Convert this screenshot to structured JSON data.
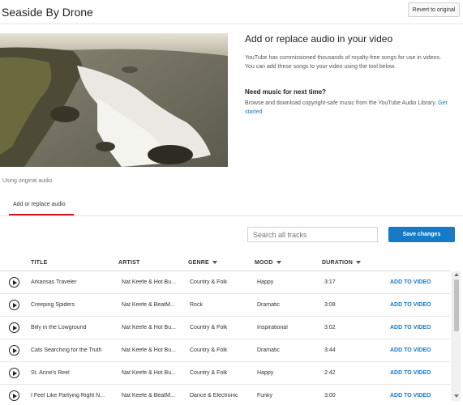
{
  "header": {
    "title": "Seaside By Drone",
    "revert_label": "Revert to original"
  },
  "info": {
    "heading": "Add or replace audio in your video",
    "description": "YouTube has commissioned thousands of royalty-free songs for use in videos. You can add these songs to your video using the tool below.",
    "subheading": "Need music for next time?",
    "description2": "Browse and download copyright-safe music from the YouTube Audio Library.",
    "link": "Get started"
  },
  "audio_status": "Using original audio",
  "tabs": [
    {
      "label": "Add or replace audio"
    }
  ],
  "search": {
    "placeholder": "Search all tracks"
  },
  "save_label": "Save changes",
  "columns": {
    "title": "TITLE",
    "artist": "ARTIST",
    "genre": "GENRE",
    "mood": "MOOD",
    "duration": "DURATION"
  },
  "tracks": [
    {
      "title": "Arkansas Traveler",
      "artist": "Nat Keefe & Hot Bu...",
      "genre": "Country & Folk",
      "mood": "Happy",
      "duration": "3:17",
      "action": "ADD TO VIDEO"
    },
    {
      "title": "Creeping Spiders",
      "artist": "Nat Keefe & BeatM...",
      "genre": "Rock",
      "mood": "Dramatic",
      "duration": "3:08",
      "action": "ADD TO VIDEO"
    },
    {
      "title": "Billy in the Lowground",
      "artist": "Nat Keefe & Hot Bu...",
      "genre": "Country & Folk",
      "mood": "Inspirational",
      "duration": "3:02",
      "action": "ADD TO VIDEO"
    },
    {
      "title": "Cats Searching for the Truth",
      "artist": "Nat Keefe & Hot Bu...",
      "genre": "Country & Folk",
      "mood": "Dramatic",
      "duration": "3:44",
      "action": "ADD TO VIDEO"
    },
    {
      "title": "St. Anne's Reel",
      "artist": "Nat Keefe & Hot Bu...",
      "genre": "Country & Folk",
      "mood": "Happy",
      "duration": "2:42",
      "action": "ADD TO VIDEO"
    },
    {
      "title": "I Feel Like Partying Right N...",
      "artist": "Nat Keefe & BeatM...",
      "genre": "Dance & Electronic",
      "mood": "Funky",
      "duration": "3:00",
      "action": "ADD TO VIDEO"
    }
  ],
  "icons": {
    "play": "play-circle-icon",
    "sort": "sort-down-icon"
  },
  "colors": {
    "accent": "#167ac6",
    "tab_underline": "#cc181e"
  }
}
